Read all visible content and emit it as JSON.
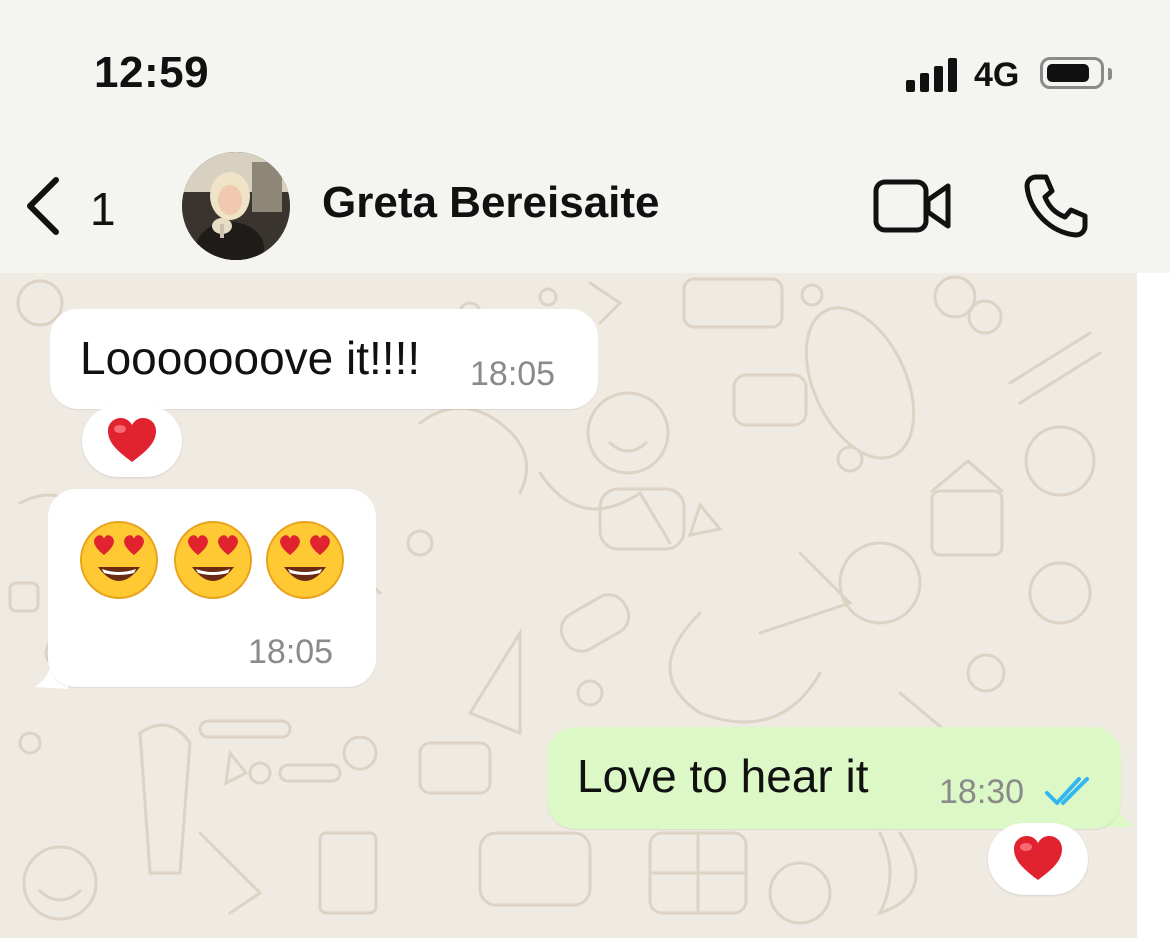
{
  "status_bar": {
    "time": "12:59",
    "network": "4G",
    "battery_level": 0.8,
    "signal_icon": "cellular-signal-icon",
    "battery_icon": "battery-icon"
  },
  "header": {
    "back_count": "1",
    "back_icon": "chevron-left-icon",
    "contact_name": "Greta Bereisaite",
    "video_icon": "video-camera-icon",
    "call_icon": "phone-icon"
  },
  "messages": [
    {
      "direction": "incoming",
      "text": "Looooooove it!!!!",
      "time": "18:05",
      "reaction": "heart-emoji"
    },
    {
      "direction": "incoming",
      "emojis": [
        "heart-eyes-emoji",
        "heart-eyes-emoji",
        "heart-eyes-emoji"
      ],
      "time": "18:05"
    },
    {
      "direction": "outgoing",
      "text": "Love to hear it",
      "time": "18:30",
      "status_icon": "double-check-read-icon",
      "reaction": "heart-emoji"
    }
  ],
  "colors": {
    "header_bg": "#f4f4f0",
    "chat_bg": "#efeae2",
    "incoming_bubble": "#ffffff",
    "outgoing_bubble": "#dcf8c6",
    "read_tick": "#34b7f1",
    "timestamp": "#8a8a8a"
  }
}
